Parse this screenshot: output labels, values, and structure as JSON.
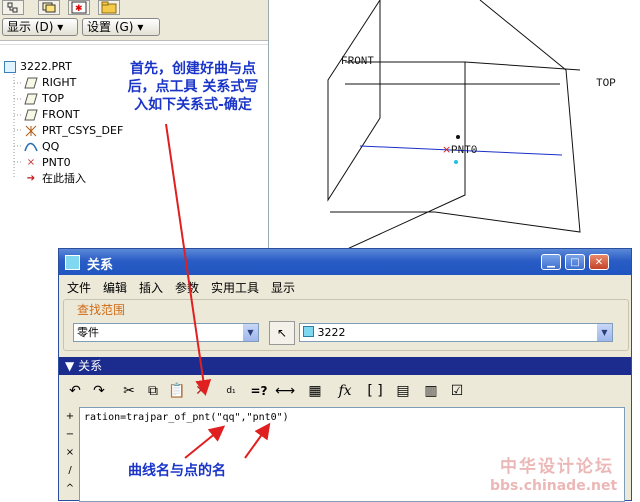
{
  "left_panel": {
    "display_button": "显示 (D)",
    "settings_button": "设置 (G)",
    "tree": [
      {
        "label": "3222.PRT",
        "icon": "part-icon"
      },
      {
        "label": "RIGHT",
        "icon": "datum-plane-icon"
      },
      {
        "label": "TOP",
        "icon": "datum-plane-icon"
      },
      {
        "label": "FRONT",
        "icon": "datum-plane-icon"
      },
      {
        "label": "PRT_CSYS_DEF",
        "icon": "csys-icon"
      },
      {
        "label": "QQ",
        "icon": "curve-icon"
      },
      {
        "label": "PNT0",
        "icon": "datum-point-icon"
      },
      {
        "label": "在此插入",
        "icon": "insert-arrow-icon"
      }
    ]
  },
  "graphics": {
    "front_label": "FRONT",
    "top_label": "TOP",
    "point_label": "PNT0"
  },
  "annotations": {
    "top_line1": "首先，创建好曲与点",
    "top_line2": "后，点工具 关系式写",
    "top_line3": "入如下关系式-确定",
    "bottom": "曲线名与点的名"
  },
  "dialog": {
    "title": "关系",
    "menus": [
      "文件",
      "编辑",
      "插入",
      "参数",
      "实用工具",
      "显示"
    ],
    "scope_label": "查找范围",
    "scope_type": "零件",
    "scope_value": "3222",
    "section_label": "关系",
    "relation_text": "ration=trajpar_of_pnt(\"qq\",\"pnt0\")",
    "side_buttons": [
      "+",
      "−",
      "×",
      "/",
      "^"
    ]
  },
  "watermark": {
    "line1": "中华设计论坛",
    "line2": "bbs.chinade.net"
  },
  "colors": {
    "annotation": "#1a35c8",
    "arrow": "#e02020",
    "title_bar": "#2a5cc5",
    "section_bar": "#1b2c8e",
    "scope_label": "#d06a14"
  }
}
